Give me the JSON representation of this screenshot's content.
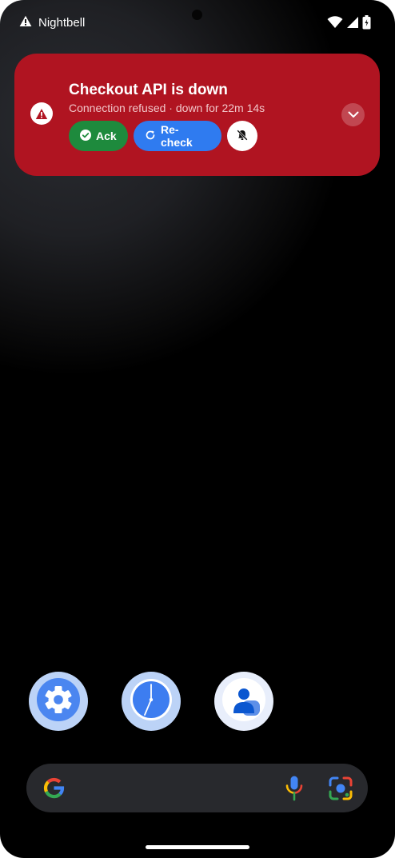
{
  "status_bar": {
    "app_name": "Nightbell",
    "alert_icon": "warning-icon",
    "icons": [
      "wifi-icon",
      "cell-signal-icon",
      "battery-icon"
    ]
  },
  "notification": {
    "title": "Checkout API is down",
    "subtitle": "Connection refused · down for 22m 14s",
    "icon": "warning-icon",
    "background": "#b01421",
    "actions": {
      "ack_label": "Ack",
      "recheck_label": "Re-check",
      "mute_icon": "bell-off-icon"
    },
    "expand_icon": "chevron-down-icon"
  },
  "dock": {
    "apps": [
      {
        "name": "Settings",
        "icon": "gear-icon"
      },
      {
        "name": "Clock",
        "icon": "clock-icon"
      },
      {
        "name": "Contacts",
        "icon": "person-icon"
      }
    ]
  },
  "search_bar": {
    "icons": [
      "google-g-icon",
      "microphone-icon",
      "lens-icon"
    ]
  },
  "colors": {
    "accent_blue": "#2f7bf0",
    "ack_green": "#1e8a3d",
    "alert_red": "#b01421"
  }
}
